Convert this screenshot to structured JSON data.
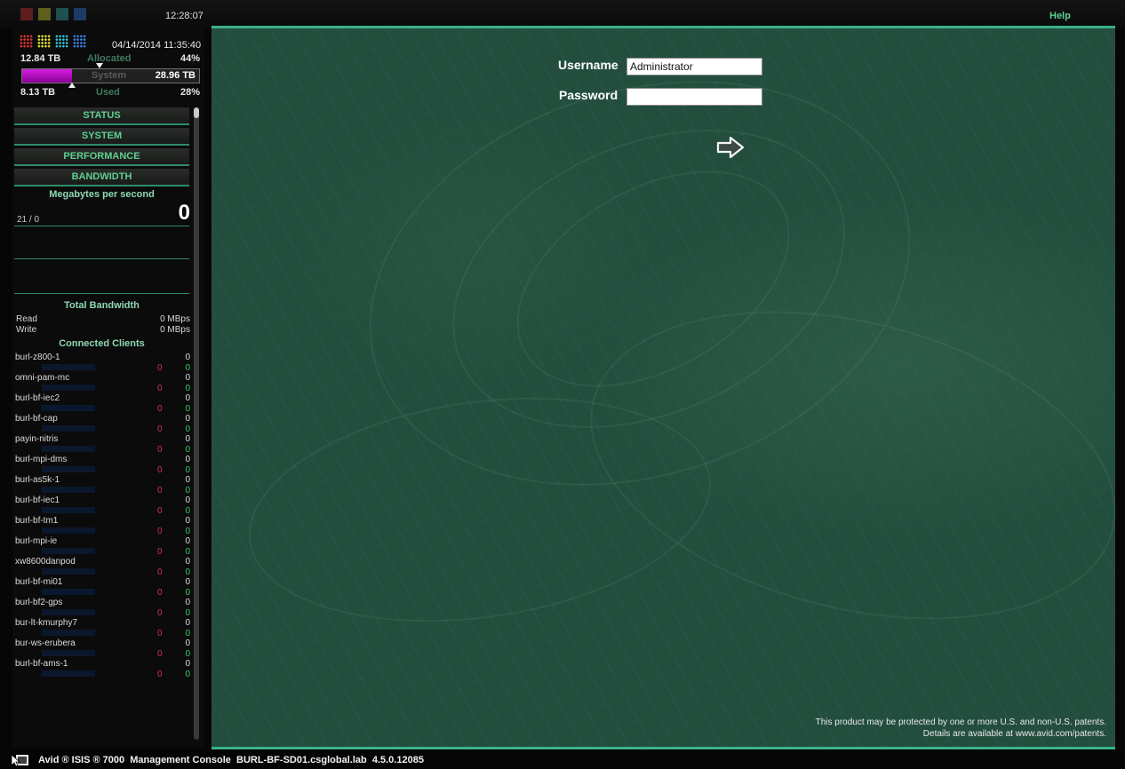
{
  "topbar": {
    "clock": "12:28:07",
    "help_label": "Help",
    "colors": [
      "#c03030",
      "#c0c030",
      "#30a0a0",
      "#3070d0"
    ]
  },
  "sidebar": {
    "date": "04/14/2014 11:35:40",
    "allocated": {
      "value": "12.84 TB",
      "label": "Allocated",
      "pct": "44%"
    },
    "system": {
      "label": "System",
      "value": "28.96 TB"
    },
    "used": {
      "value": "8.13 TB",
      "label": "Used",
      "pct": "28%"
    },
    "used_fraction": 0.28,
    "allocated_fraction": 0.44,
    "nav": [
      "STATUS",
      "SYSTEM",
      "PERFORMANCE",
      "BANDWIDTH"
    ],
    "mbps_title": "Megabytes per second",
    "mbps_value": "0",
    "ratio": "21 / 0",
    "total_bandwidth": "Total Bandwidth",
    "read_label": "Read",
    "read_value": "0 MBps",
    "write_label": "Write",
    "write_value": "0 MBps",
    "clients_title": "Connected Clients",
    "clients": [
      {
        "name": "burl-z800-1",
        "val": "0",
        "read": "0",
        "write": "0"
      },
      {
        "name": "omni-pam-mc",
        "val": "0",
        "read": "0",
        "write": "0"
      },
      {
        "name": "burl-bf-iec2",
        "val": "0",
        "read": "0",
        "write": "0"
      },
      {
        "name": "burl-bf-cap",
        "val": "0",
        "read": "0",
        "write": "0"
      },
      {
        "name": "payin-nitris",
        "val": "0",
        "read": "0",
        "write": "0"
      },
      {
        "name": "burl-mpi-dms",
        "val": "0",
        "read": "0",
        "write": "0"
      },
      {
        "name": "burl-as5k-1",
        "val": "0",
        "read": "0",
        "write": "0"
      },
      {
        "name": "burl-bf-iec1",
        "val": "0",
        "read": "0",
        "write": "0"
      },
      {
        "name": "burl-bf-tm1",
        "val": "0",
        "read": "0",
        "write": "0"
      },
      {
        "name": "burl-mpi-ie",
        "val": "0",
        "read": "0",
        "write": "0"
      },
      {
        "name": "xw8600danpod",
        "val": "0",
        "read": "0",
        "write": "0"
      },
      {
        "name": "burl-bf-mi01",
        "val": "0",
        "read": "0",
        "write": "0"
      },
      {
        "name": "burl-bf2-gps",
        "val": "0",
        "read": "0",
        "write": "0"
      },
      {
        "name": "bur-lt-kmurphy7",
        "val": "0",
        "read": "0",
        "write": "0"
      },
      {
        "name": "bur-ws-erubera",
        "val": "0",
        "read": "0",
        "write": "0"
      },
      {
        "name": "burl-bf-ams-1",
        "val": "0",
        "read": "0",
        "write": "0"
      }
    ]
  },
  "login": {
    "username_label": "Username",
    "username_value": "Administrator",
    "password_label": "Password",
    "password_value": "",
    "submit_icon": "arrow-right-icon"
  },
  "patent": {
    "line1": "This product may be protected by one or more U.S. and non-U.S. patents.",
    "line2": "Details are available at www.avid.com/patents."
  },
  "footer": {
    "text": "Avid ® ISIS ® 7000  Management Console  BURL-BF-SD01.csglobal.lab  4.5.0.12085"
  }
}
